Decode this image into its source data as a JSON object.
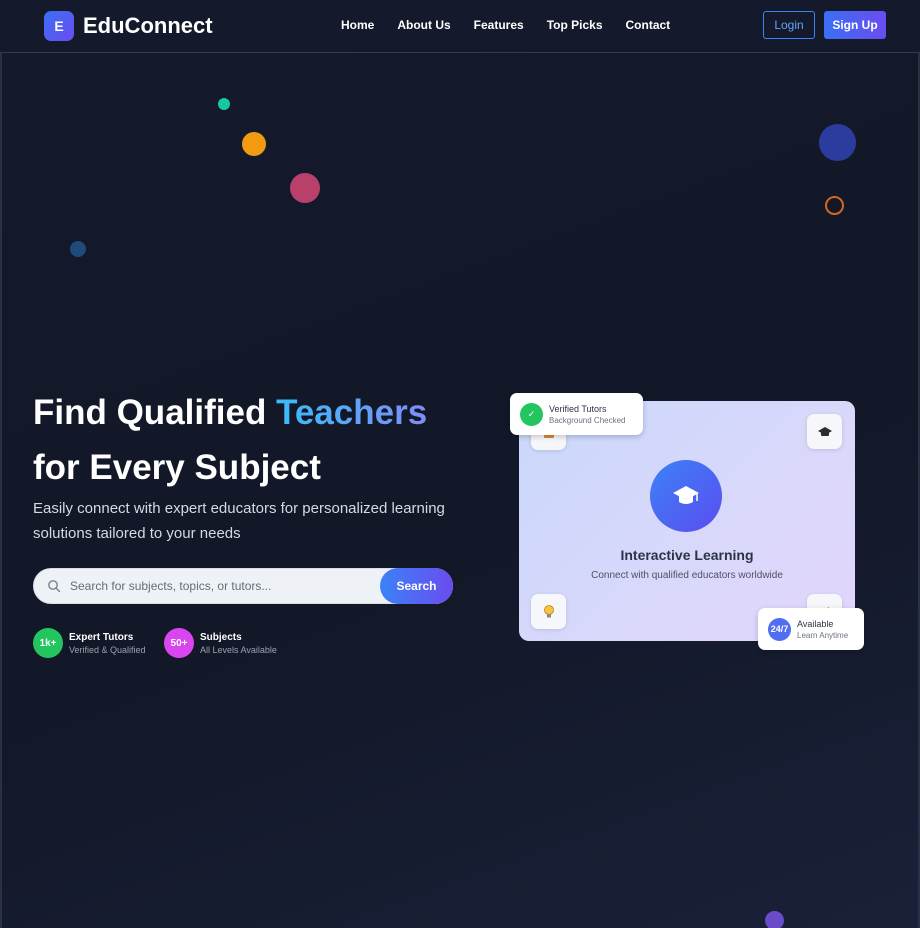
{
  "app": {
    "logo_letter": "E",
    "title": "EduConnect"
  },
  "nav": {
    "links": [
      "Home",
      "About Us",
      "Features",
      "Top Picks",
      "Contact"
    ],
    "login_label": "Login",
    "signup_label": "Sign Up"
  },
  "hero": {
    "title_part1": "Find Qualified ",
    "title_accent": "Teachers",
    "title_line2": "for Every Subject",
    "subtitle": "Easily connect with expert educators for personalized learning solutions tailored to your needs",
    "search_placeholder": "Search for subjects, topics, or tutors...",
    "search_button": "Search"
  },
  "stats": [
    {
      "value": "1k+",
      "title": "Expert Tutors",
      "desc": "Verified & Qualified",
      "color": "#22c55e"
    },
    {
      "value": "50+",
      "title": "Subjects",
      "desc": "All Levels Available",
      "color": "#d946ef"
    }
  ],
  "card": {
    "title": "Interactive Learning",
    "subtitle": "Connect with qualified educators worldwide",
    "icons": [
      "book-icon",
      "graduation-cap-icon",
      "lightbulb-icon",
      "pencil-icon"
    ]
  },
  "badges": {
    "verified": {
      "title": "Verified Tutors",
      "desc": "Background Checked",
      "symbol": "✓",
      "color": "#22c55e"
    },
    "available": {
      "value": "24/7",
      "title": "Available",
      "desc": "Learn Anytime",
      "color": "#4f6ef0"
    }
  },
  "colors": {
    "accent": "#3b82f6",
    "brand_gradient_end": "#6a4cf0",
    "background": "#141a2c"
  }
}
